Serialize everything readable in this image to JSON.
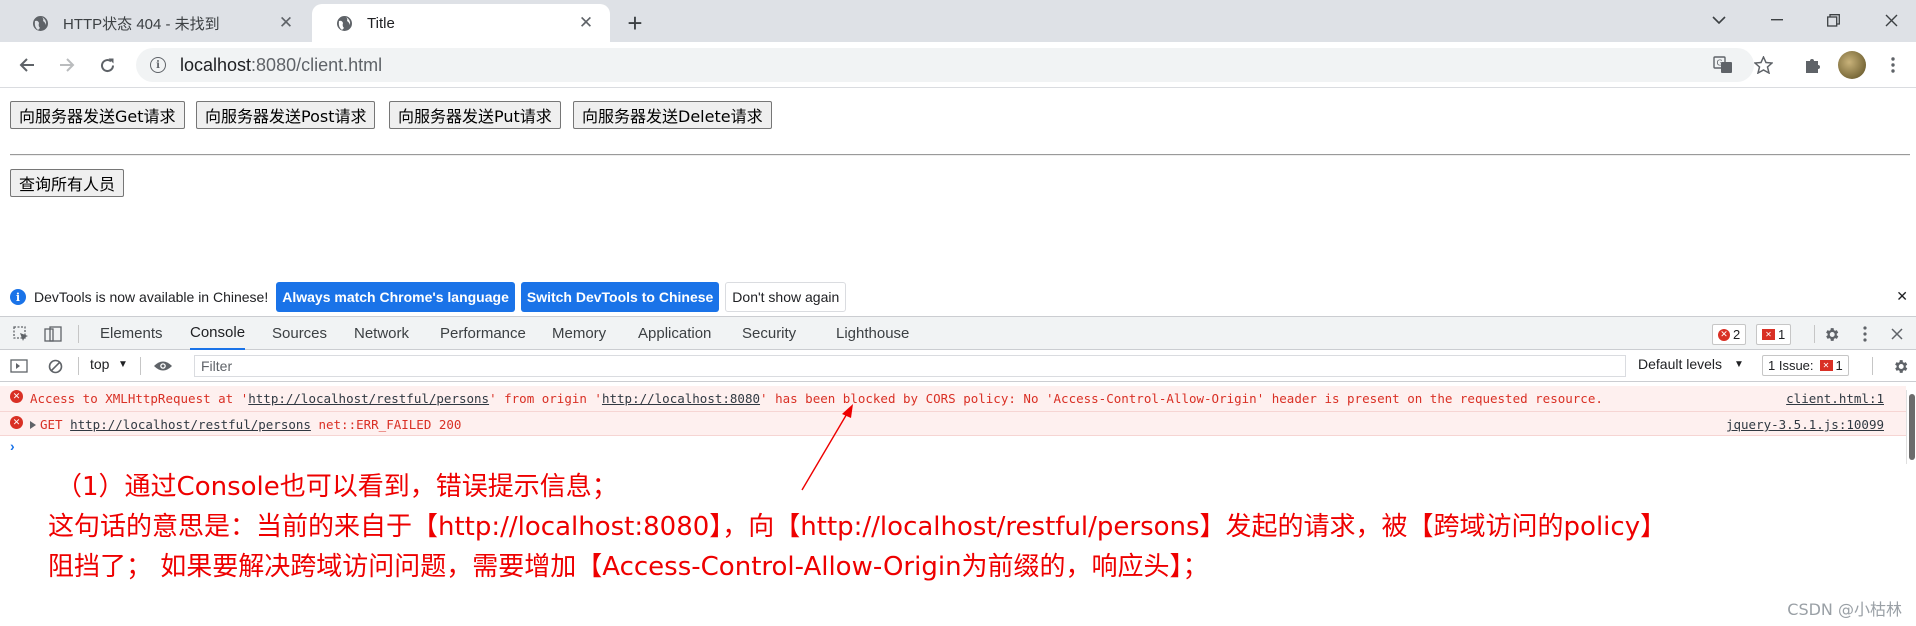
{
  "browser": {
    "tabs": [
      {
        "title": "HTTP状态 404 - 未找到",
        "favicon": "globe-icon",
        "active": false
      },
      {
        "title": "Title",
        "favicon": "globe-icon",
        "active": true
      }
    ],
    "new_tab": "+",
    "address": {
      "host": "localhost",
      "path": ":8080/client.html"
    }
  },
  "page": {
    "buttons": [
      "向服务器发送Get请求",
      "向服务器发送Post请求",
      "向服务器发送Put请求",
      "向服务器发送Delete请求"
    ],
    "query_button": "查询所有人员"
  },
  "devtools": {
    "infobar": {
      "message": "DevTools is now available in Chinese!",
      "btn_match": "Always match Chrome's language",
      "btn_switch": "Switch DevTools to Chinese",
      "btn_dismiss": "Don't show again"
    },
    "tabs": [
      "Elements",
      "Console",
      "Sources",
      "Network",
      "Performance",
      "Memory",
      "Application",
      "Security",
      "Lighthouse"
    ],
    "active_tab": "Console",
    "error_count": "2",
    "issue_count": "1",
    "console_bar": {
      "context": "top",
      "filter_placeholder": "Filter",
      "levels": "Default levels",
      "issues_label": "1 Issue:",
      "issues_count": "1"
    },
    "messages": [
      {
        "level": "error",
        "parts": [
          {
            "text": "Access to XMLHttpRequest at '",
            "link": false
          },
          {
            "text": "http://localhost/restful/persons",
            "link": true
          },
          {
            "text": "' from origin '",
            "link": false
          },
          {
            "text": "http://localhost:8080",
            "link": true
          },
          {
            "text": "' has been blocked by CORS policy: No 'Access-Control-Allow-Origin' header is present on the requested resource.",
            "link": false
          }
        ],
        "source": "client.html:1"
      },
      {
        "level": "error",
        "method": "GET",
        "url": "http://localhost/restful/persons",
        "status": "net::ERR_FAILED 200",
        "source": "jquery-3.5.1.js:10099"
      }
    ],
    "prompt": "›"
  },
  "annotation": {
    "line1": "（1）通过Console也可以看到，错误提示信息；",
    "line2": "这句话的意思是：当前的来自于【http://localhost:8080】，向【http://localhost/restful/persons】发起的请求，被【跨域访问的policy】",
    "line3": "阻挡了；   如果要解决跨域访问问题，需要增加【Access-Control-Allow-Origin为前缀的，响应头】；",
    "color": "#ee0000"
  },
  "watermark": "CSDN @小枯林"
}
